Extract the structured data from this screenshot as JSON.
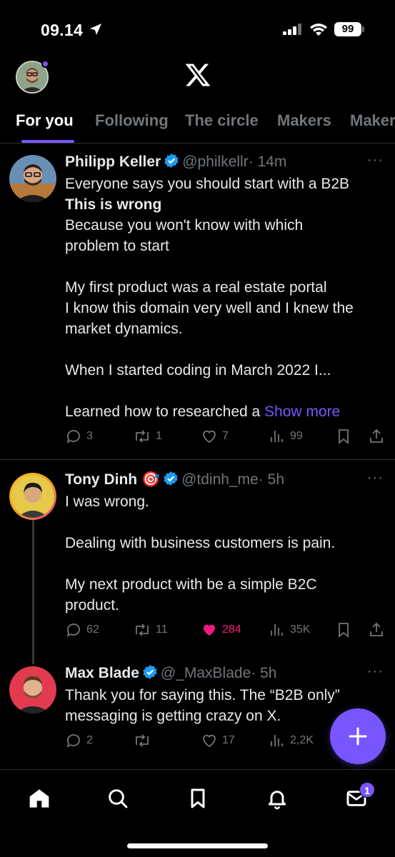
{
  "status_bar": {
    "time": "09.14",
    "battery": "99"
  },
  "tabs": [
    {
      "label": "For you"
    },
    {
      "label": "Following"
    },
    {
      "label": "The circle"
    },
    {
      "label": "Makers"
    },
    {
      "label": "Makers"
    }
  ],
  "posts": [
    {
      "name": "Philipp Keller",
      "handle": "@philkellr",
      "time": "· 14m",
      "lines": [
        "Everyone says you should start with a B2B",
        "This is wrong",
        "Because you won't know with which",
        "problem to start",
        "",
        "My first product was a real estate portal",
        "I know this domain very well and I knew the",
        "market dynamics.",
        "",
        "When I started coding in March 2022 I...",
        "",
        "Learned how to researched a "
      ],
      "show_more": "Show more",
      "replies": "3",
      "reposts": "1",
      "likes": "7",
      "views": "99"
    },
    {
      "name": "Tony Dinh",
      "emoji": "🎯",
      "handle": "@tdinh_me",
      "time": "· 5h",
      "lines": [
        "I was wrong.",
        "",
        "Dealing with business customers is pain.",
        "",
        "My next product with be a simple B2C",
        "product."
      ],
      "replies": "62",
      "reposts": "11",
      "likes": "284",
      "views": "35K"
    },
    {
      "name": "Max Blade",
      "handle": "@_MaxBlade",
      "time": "· 5h",
      "lines": [
        "Thank you for saying this. The “B2B only”",
        "messaging is getting crazy on X."
      ],
      "replies": "2",
      "reposts": "",
      "likes": "17",
      "views": "2,2K"
    }
  ],
  "more_glyph": "···",
  "messages_badge": "1",
  "colors": {
    "accent": "#7856ff",
    "like": "#f91880",
    "verified": "#1d9bf0"
  }
}
